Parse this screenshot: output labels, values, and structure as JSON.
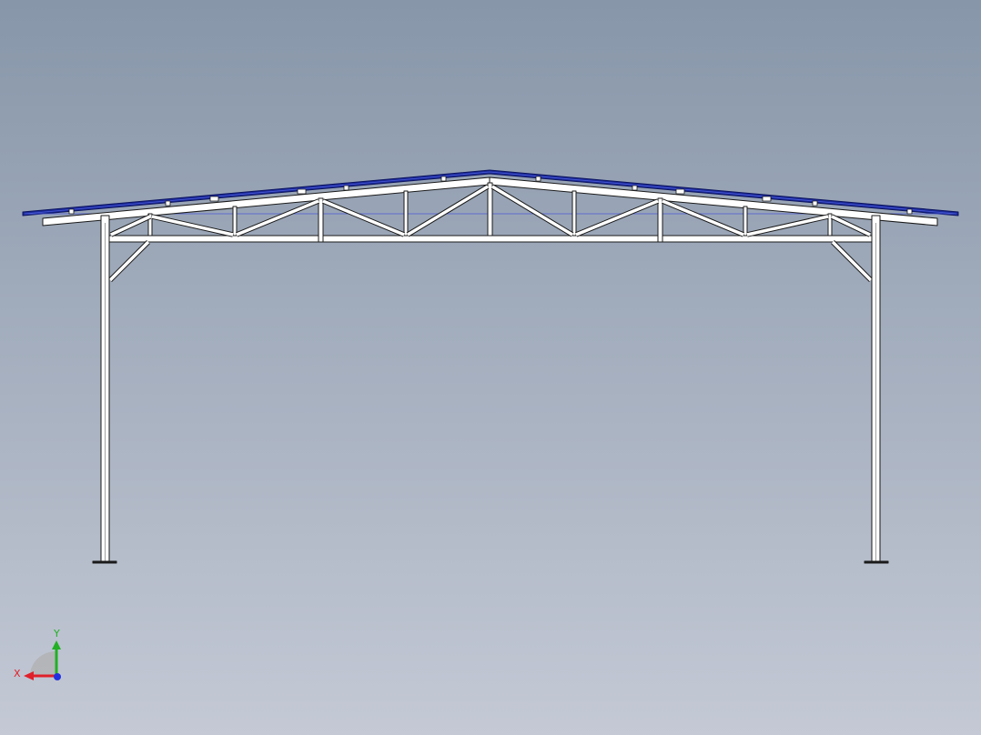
{
  "viewport": {
    "background_top": "#8796a9",
    "background_bottom": "#c4c9d5",
    "model_fill": "#ffffff",
    "model_edge": "#1a1a1a",
    "roof_color": "#1b2a9a"
  },
  "triad": {
    "x_label": "X",
    "y_label": "Y",
    "x_color": "#e0202a",
    "y_color": "#22b024",
    "z_color": "#2030e0"
  }
}
